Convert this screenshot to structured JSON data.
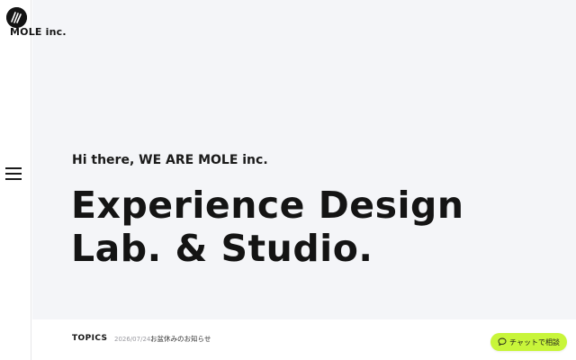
{
  "brand": {
    "name": "MOLE inc."
  },
  "hero": {
    "greeting": "Hi there, WE ARE MOLE inc.",
    "headline_line1": "Experience Design",
    "headline_line2": "Lab. & Studio."
  },
  "topics": {
    "label": "TOPICS",
    "date": "2026/07/24",
    "title": "お盆休みのお知らせ"
  },
  "chat": {
    "label": "チャットで相談"
  },
  "icons": {
    "logo": "mole-logo-icon",
    "menu": "hamburger-menu-icon",
    "chat": "chat-bubble-icon"
  },
  "colors": {
    "hero_background": "#f4f5f8",
    "chat_button": "#c8f53a",
    "text": "#141414"
  }
}
